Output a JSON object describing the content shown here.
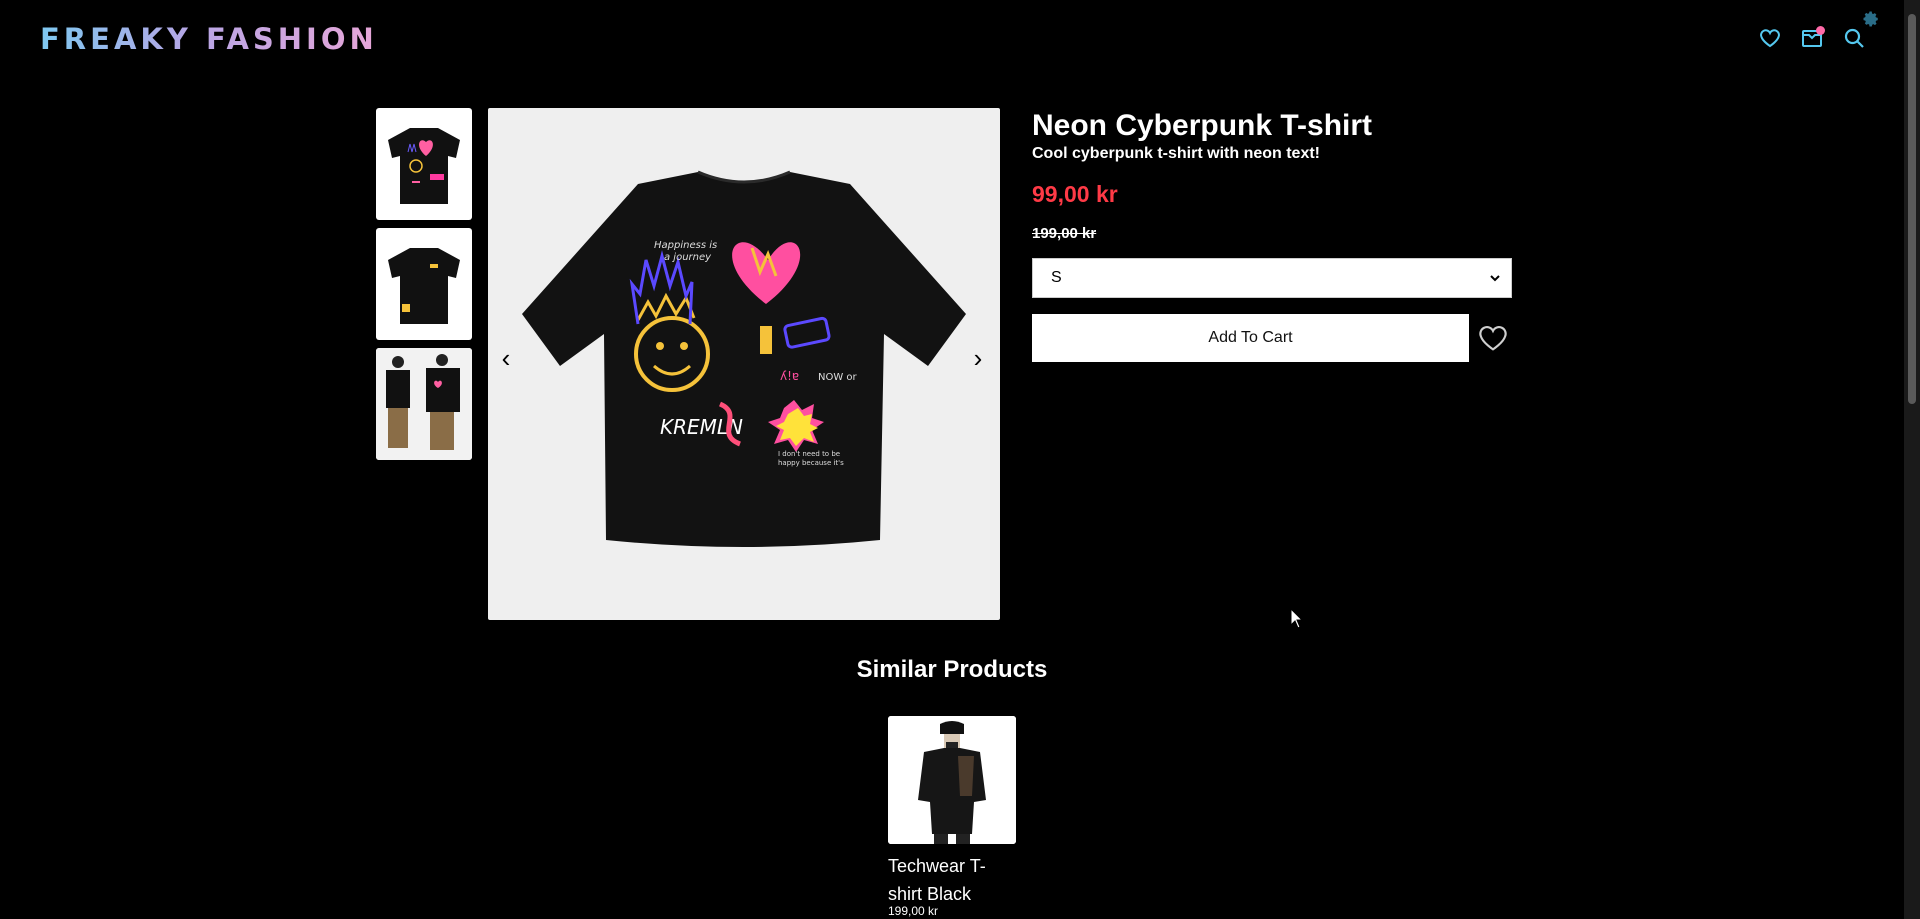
{
  "header": {
    "logo": "FREAKY FASHION",
    "icons": [
      "heart-icon",
      "cart-icon",
      "search-icon",
      "gear-icon"
    ],
    "cart_has_items": true,
    "accent": "#55c8ef"
  },
  "gallery": {
    "thumbnails": [
      "T-shirt back view",
      "T-shirt front view",
      "Model wearing T-shirt"
    ],
    "prev_label": "‹",
    "next_label": "›"
  },
  "product": {
    "title": "Neon Cyberpunk T-shirt",
    "description": "Cool cyberpunk t-shirt with neon text!",
    "price": "99,00 kr",
    "old_price": "199,00 kr",
    "size_selected": "S",
    "add_to_cart_label": "Add To Cart",
    "price_color": "#ff3a46"
  },
  "similar": {
    "title": "Similar Products",
    "items": [
      {
        "name": "Techwear T-shirt Black",
        "price": "199,00 kr"
      }
    ]
  }
}
